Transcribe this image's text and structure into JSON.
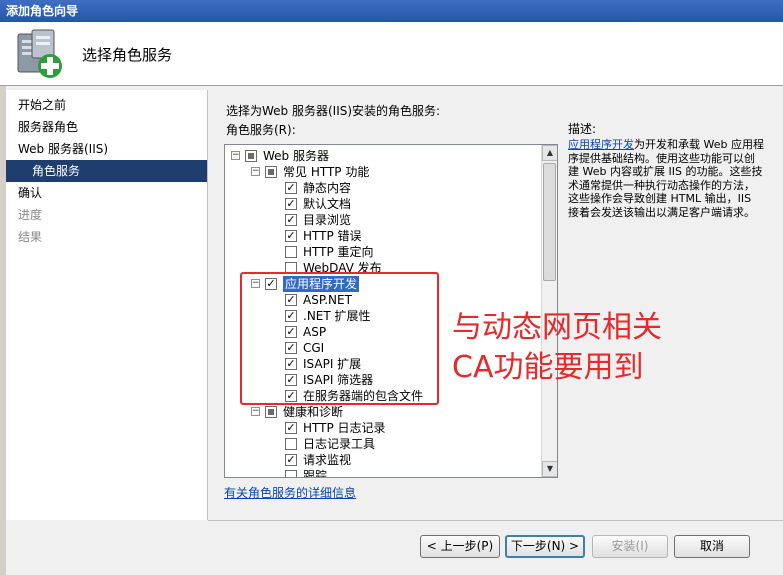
{
  "window": {
    "title": "添加角色向导"
  },
  "header": {
    "title": "选择角色服务"
  },
  "steps": [
    {
      "label": "开始之前",
      "state": "normal"
    },
    {
      "label": "服务器角色",
      "state": "normal"
    },
    {
      "label": "Web 服务器(IIS)",
      "state": "normal"
    },
    {
      "label": "角色服务",
      "state": "current"
    },
    {
      "label": "确认",
      "state": "normal"
    },
    {
      "label": "进度",
      "state": "disabled"
    },
    {
      "label": "结果",
      "state": "disabled"
    }
  ],
  "main": {
    "prompt": "选择为Web 服务器(IIS)安装的角色服务:",
    "role_services_label": "角色服务(R):",
    "tree": [
      {
        "label": "Web 服务器",
        "level": 0,
        "expander": "minus",
        "check": "partial"
      },
      {
        "label": "常见 HTTP 功能",
        "level": 1,
        "expander": "minus",
        "check": "partial"
      },
      {
        "label": "静态内容",
        "level": 2,
        "check": "checked"
      },
      {
        "label": "默认文档",
        "level": 2,
        "check": "checked"
      },
      {
        "label": "目录浏览",
        "level": 2,
        "check": "checked"
      },
      {
        "label": "HTTP 错误",
        "level": 2,
        "check": "checked"
      },
      {
        "label": "HTTP 重定向",
        "level": 2,
        "check": "unchecked"
      },
      {
        "label": "WebDAV 发布",
        "level": 2,
        "check": "unchecked"
      },
      {
        "label": "应用程序开发",
        "level": 1,
        "expander": "minus",
        "check": "checked",
        "selected": true
      },
      {
        "label": "ASP.NET",
        "level": 2,
        "check": "checked"
      },
      {
        "label": ".NET 扩展性",
        "level": 2,
        "check": "checked"
      },
      {
        "label": "ASP",
        "level": 2,
        "check": "checked"
      },
      {
        "label": "CGI",
        "level": 2,
        "check": "checked"
      },
      {
        "label": "ISAPI 扩展",
        "level": 2,
        "check": "checked"
      },
      {
        "label": "ISAPI 筛选器",
        "level": 2,
        "check": "checked"
      },
      {
        "label": "在服务器端的包含文件",
        "level": 2,
        "check": "checked"
      },
      {
        "label": "健康和诊断",
        "level": 1,
        "expander": "minus",
        "check": "partial"
      },
      {
        "label": "HTTP 日志记录",
        "level": 2,
        "check": "checked"
      },
      {
        "label": "日志记录工具",
        "level": 2,
        "check": "unchecked"
      },
      {
        "label": "请求监视",
        "level": 2,
        "check": "checked"
      },
      {
        "label": "跟踪",
        "level": 2,
        "check": "unchecked"
      }
    ],
    "description_label": "描述:",
    "description_link": "应用程序开发",
    "description_text": "为开发和承载 Web 应用程序提供基础结构。使用这些功能可以创建 Web 内容或扩展 IIS 的功能。这些技术通常提供一种执行动态操作的方法，这些操作会导致创建 HTML 输出，IIS 接着会发送该输出以满足客户端请求。",
    "details_link": "有关角色服务的详细信息"
  },
  "annotation": {
    "line1": "与动态网页相关",
    "line2": "CA功能要用到"
  },
  "buttons": {
    "prev": "< 上一步(P)",
    "next": "下一步(N) >",
    "install": "安装(I)",
    "cancel": "取消"
  }
}
